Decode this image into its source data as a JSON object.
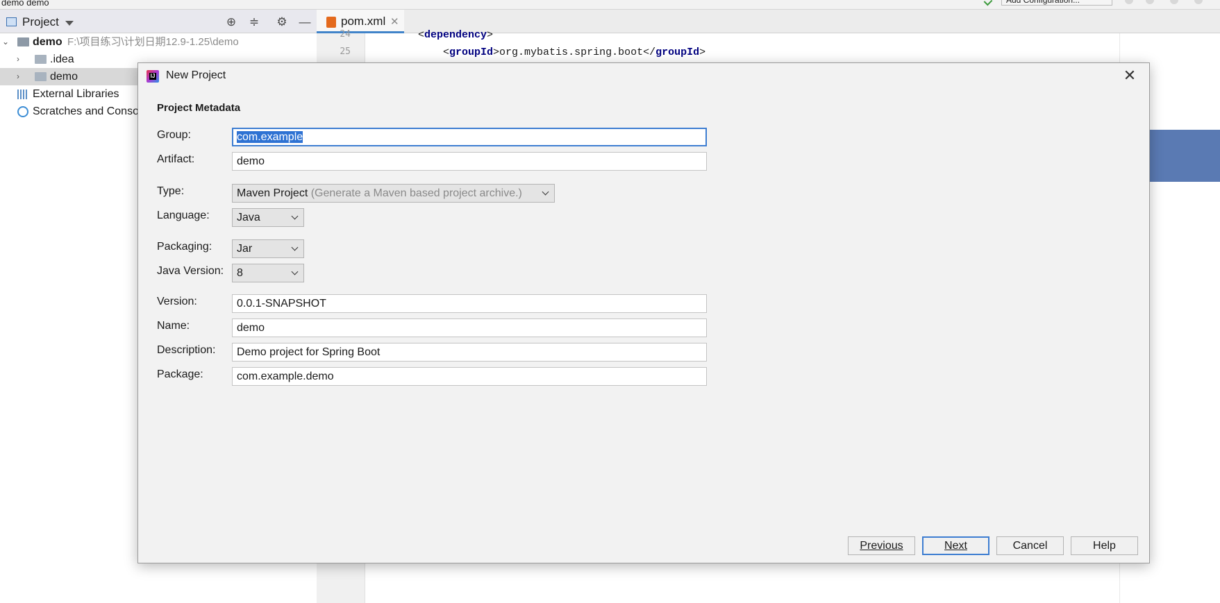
{
  "ide": {
    "breadcrumb": "demo  demo",
    "add_configuration": "Add Configuration...",
    "project_panel": {
      "title": "Project",
      "tree": [
        {
          "label": "demo",
          "path": "F:\\项目练习\\计划日期12.9-1.25\\demo"
        },
        {
          "label": ".idea"
        },
        {
          "label": "demo"
        },
        {
          "label": "External Libraries"
        },
        {
          "label": "Scratches and Conso"
        }
      ]
    },
    "editor": {
      "tab_name": "pom.xml",
      "line_numbers": [
        "24",
        "25"
      ],
      "code": {
        "line1_tag": "dependency",
        "line2_tag": "groupId",
        "line2_value": "org.mybatis.spring.boot"
      }
    }
  },
  "dialog": {
    "title": "New Project",
    "section_title": "Project Metadata",
    "fields": {
      "group": {
        "label": "Group:",
        "value": "com.example"
      },
      "artifact": {
        "label": "Artifact:",
        "value": "demo"
      },
      "type": {
        "label": "Type:",
        "value": "Maven Project",
        "hint": "(Generate a Maven based project archive.)"
      },
      "language": {
        "label": "Language:",
        "value": "Java"
      },
      "packaging": {
        "label": "Packaging:",
        "value": "Jar"
      },
      "java_version": {
        "label": "Java Version:",
        "value": "8"
      },
      "version": {
        "label": "Version:",
        "value": "0.0.1-SNAPSHOT"
      },
      "name": {
        "label": "Name:",
        "value": "demo"
      },
      "description": {
        "label": "Description:",
        "value": "Demo project for Spring Boot"
      },
      "package": {
        "label": "Package:",
        "value": "com.example.demo"
      }
    },
    "buttons": {
      "previous": "Previous",
      "next": "Next",
      "cancel": "Cancel",
      "help": "Help"
    }
  }
}
